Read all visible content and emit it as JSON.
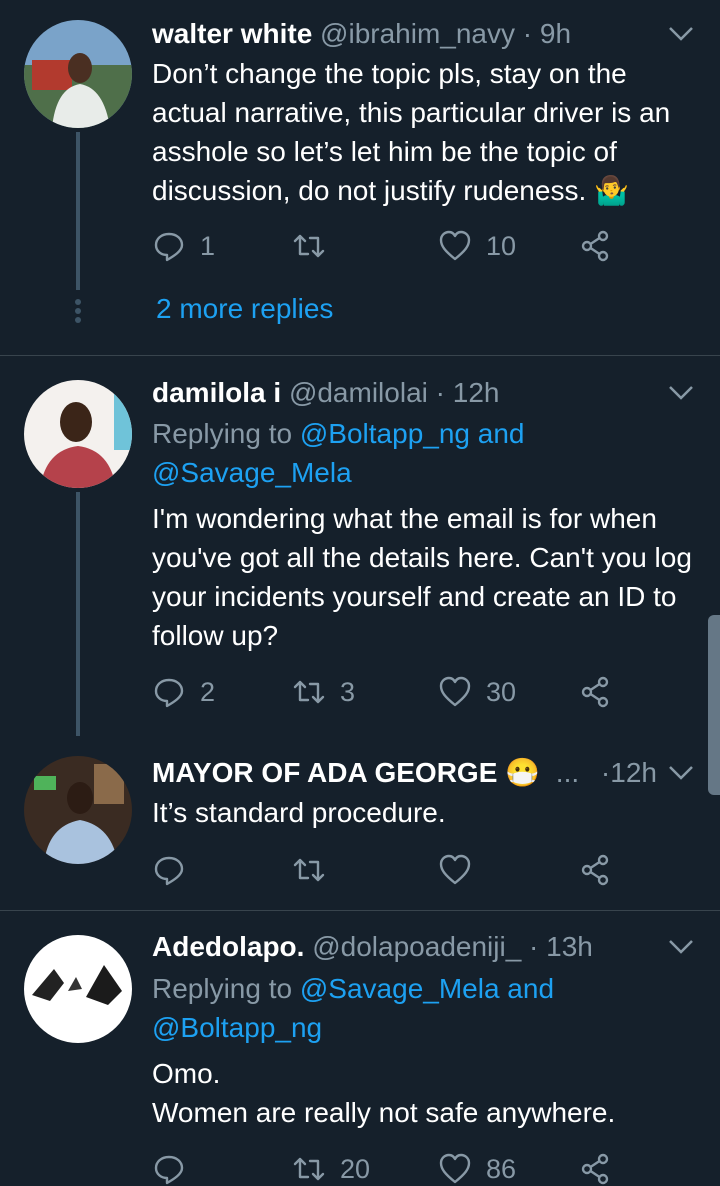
{
  "tweets": [
    {
      "name": "walter white",
      "handle": "@ibrahim_navy",
      "time": "9h",
      "body": "Don’t change the topic pls, stay on the actual narrative, this particular driver is an asshole so let’s let him be the topic of discussion, do not justify rudeness. 🤷‍♂️",
      "replies": "1",
      "retweets": "",
      "likes": "10"
    },
    {
      "name": "damilola i",
      "handle": "@damilolai",
      "time": "12h",
      "replying_prefix": "Replying to ",
      "replying_link1": "@Boltapp_ng",
      "replying_and": " and",
      "replying_link2": "@Savage_Mela",
      "body": "I'm wondering what the email is for when you've got all the details here. Can't you log your incidents yourself and create an ID to follow up?",
      "replies": "2",
      "retweets": "3",
      "likes": "30"
    },
    {
      "name": "MAYOR OF ADA GEORGE 😷",
      "ellipsis": "...",
      "time": "12h",
      "body": "It’s standard procedure.",
      "replies": "",
      "retweets": "",
      "likes": ""
    },
    {
      "name": "Adedolapo.",
      "handle": "@dolapoadeniji_",
      "time": "13h",
      "replying_prefix": "Replying to ",
      "replying_link1": "@Savage_Mela",
      "replying_and": " and",
      "replying_link2": "@Boltapp_ng",
      "body_line1": "Omo.",
      "body_line2": "Women are really not safe anywhere.",
      "replies": "",
      "retweets": "20",
      "likes": "86"
    }
  ],
  "more_replies": "2 more replies",
  "colors": {
    "bg": "#15202b",
    "muted": "#8899a6",
    "link": "#1da1f2",
    "border": "#38444d"
  }
}
